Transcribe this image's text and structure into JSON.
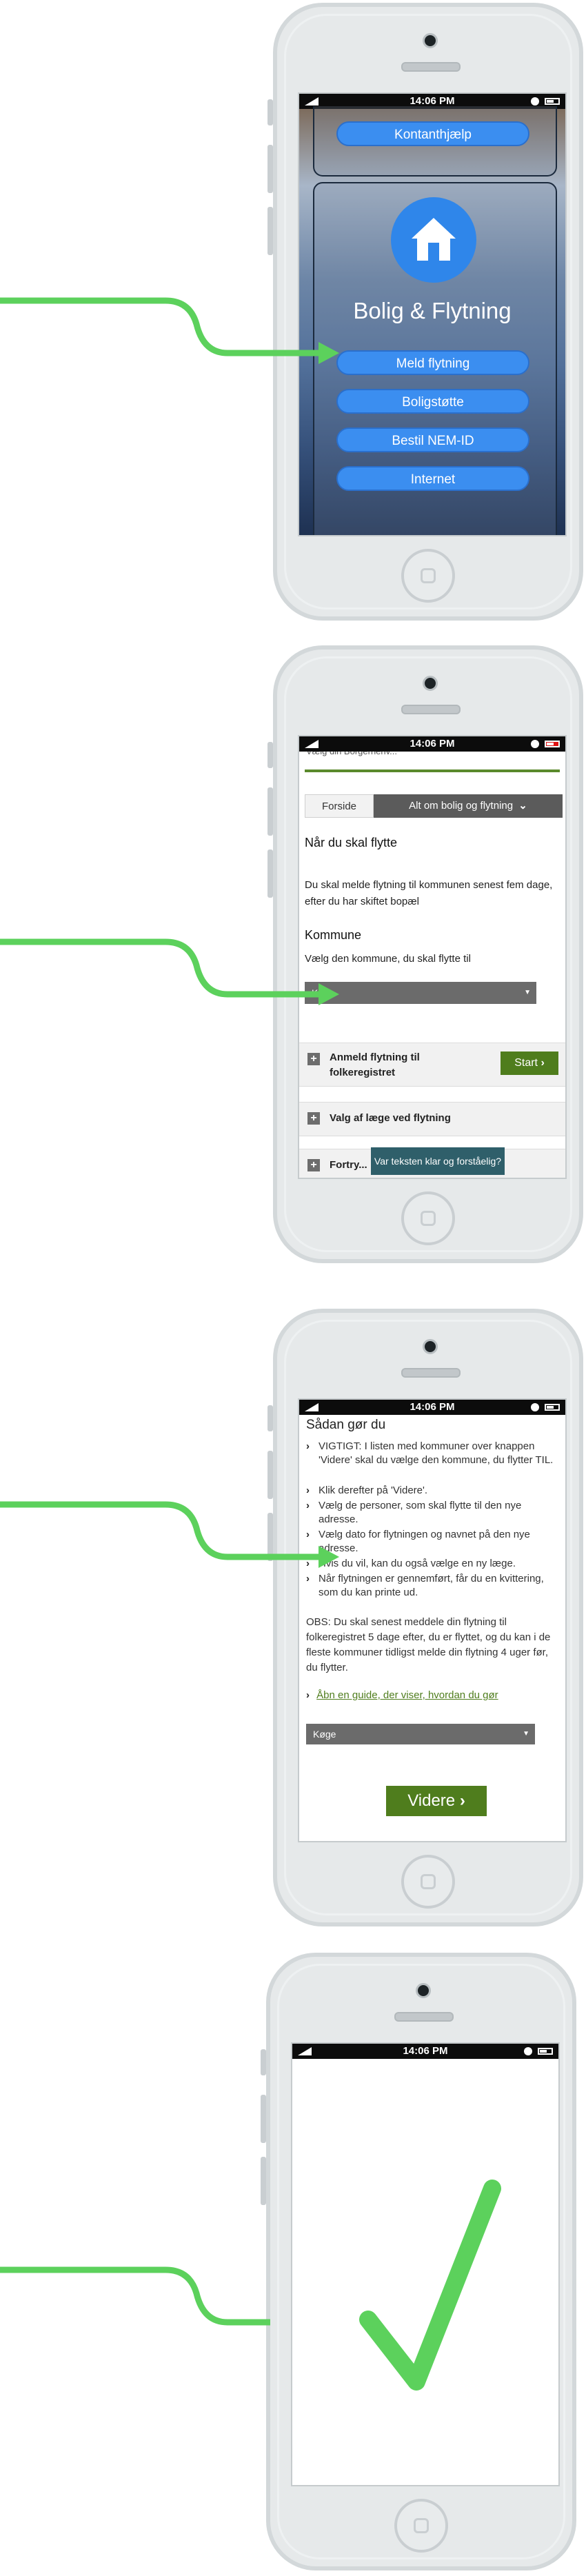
{
  "colors": {
    "arrow": "#5cd15c",
    "phone_body": "#e6e9ea",
    "app_button": "#3b8ef0",
    "icon_circle": "#2f86ea",
    "green_bar": "#5a8a2c",
    "start_button": "#4f7d1d",
    "tab_active": "#5b5b5b",
    "select_bg": "#6b6b6b",
    "feedback_bg": "#2f5f6a",
    "check": "#5cd15c"
  },
  "status_bar": {
    "time": "14:06 PM"
  },
  "screen1": {
    "top_button": "Kontanthjælp",
    "icon": "house-icon",
    "title": "Bolig & Flytning",
    "buttons": [
      "Meld flytning",
      "Boligstøtte",
      "Bestil NEM-ID",
      "Internet"
    ]
  },
  "screen2": {
    "breadcrumb_partial": "Vælg din Borgerhenv...",
    "tabs": [
      "Forside",
      "Alt om bolig og flytning"
    ],
    "heading": "Når du skal flytte",
    "intro": "Du skal melde flytning til kommunen senest fem dage, efter du har skiftet bopæl",
    "kommune_heading": "Kommune",
    "kommune_label": "Vælg den kommune, du skal flytte til",
    "select_value": "Køge",
    "accordion": [
      {
        "label": "Anmeld flytning til folkeregistret",
        "button": "Start"
      },
      {
        "label": "Valg af læge ved flytning"
      },
      {
        "label": "Fortry..."
      }
    ],
    "feedback": "Var teksten klar og forståelig?"
  },
  "screen3": {
    "heading": "Sådan gør du",
    "steps": [
      "VIGTIGT: I listen med kommuner over knappen 'Videre' skal du vælge den kommune, du flytter TIL.",
      "Klik derefter på 'Videre'.",
      "Vælg de personer, som skal flytte til den nye adresse.",
      "Vælg dato for flytningen og navnet på den nye adresse.",
      "Hvis du vil, kan du også vælge en ny læge.",
      "Når flytningen er gennemført, får du en kvittering, som du kan printe ud."
    ],
    "obs": "OBS: Du skal senest meddele din flytning til folkeregistret 5 dage efter, du er flyttet, og du kan i de fleste kommuner tidligst melde din flytning 4 uger før, du flytter.",
    "guide_link": "Åbn en guide, der viser, hvordan du gør",
    "select_value": "Køge",
    "next_button": "Videre"
  },
  "screen4": {
    "icon": "checkmark-icon"
  }
}
